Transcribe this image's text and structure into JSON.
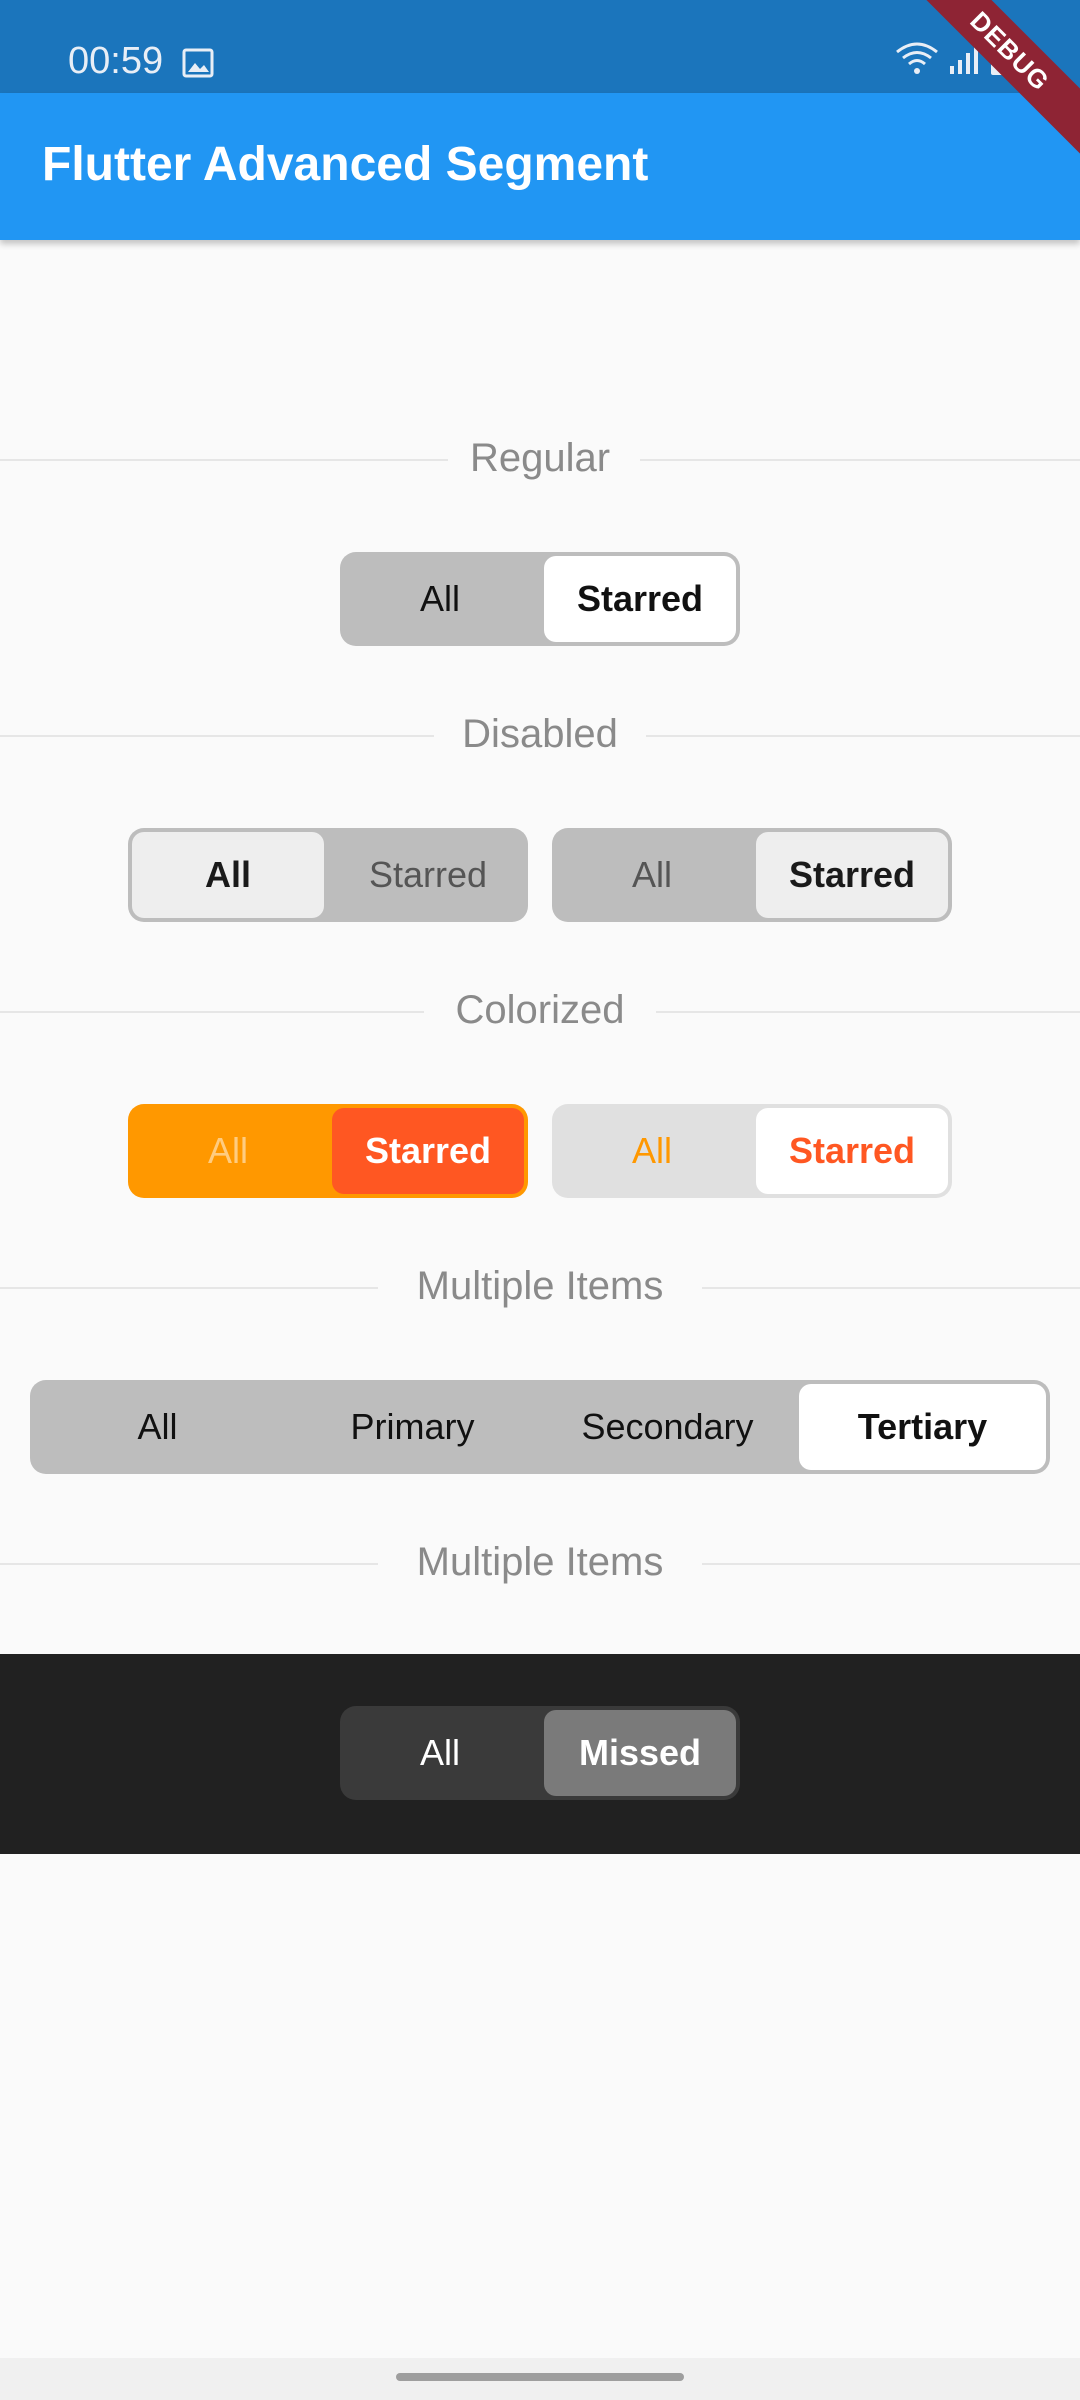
{
  "status_bar": {
    "time": "00:59"
  },
  "debug_banner": "DEBUG",
  "app_bar": {
    "title": "Flutter Advanced Segment"
  },
  "sections": {
    "regular": "Regular",
    "disabled": "Disabled",
    "colorized": "Colorized",
    "multiple_items_1": "Multiple Items",
    "multiple_items_2": "Multiple Items"
  },
  "segments": {
    "regular": {
      "items": [
        "All",
        "Starred"
      ],
      "selected": "Starred"
    },
    "disabled_a": {
      "items": [
        "All",
        "Starred"
      ],
      "selected": "All"
    },
    "disabled_b": {
      "items": [
        "All",
        "Starred"
      ],
      "selected": "Starred"
    },
    "colorized_a": {
      "items": [
        "All",
        "Starred"
      ],
      "selected": "Starred"
    },
    "colorized_b": {
      "items": [
        "All",
        "Starred"
      ],
      "selected": "Starred"
    },
    "multiple": {
      "items": [
        "All",
        "Primary",
        "Secondary",
        "Tertiary"
      ],
      "selected": "Tertiary"
    },
    "dark": {
      "items": [
        "All",
        "Missed"
      ],
      "selected": "Missed"
    }
  },
  "colors": {
    "app_bar": "#2196f3",
    "status_bar": "#1b75bc",
    "orange": "#ff9800",
    "deep_orange": "#ff5722",
    "segment_bg": "#bdbdbd",
    "dark_bg": "#212121"
  }
}
